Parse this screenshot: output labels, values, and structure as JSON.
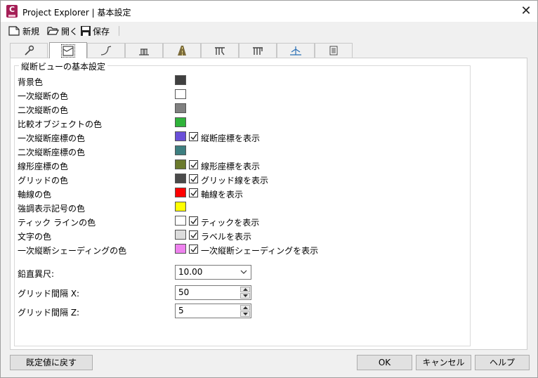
{
  "window": {
    "title": "Project Explorer | 基本設定",
    "app_icon_letter": "C",
    "close_glyph": "✕"
  },
  "toolbar": {
    "new_label": "新規",
    "open_label": "開く",
    "save_label": "保存"
  },
  "tabs": [
    {
      "icon": "wrench-icon",
      "active": false
    },
    {
      "icon": "profile-view-icon",
      "active": true
    },
    {
      "icon": "alignment-icon",
      "active": false
    },
    {
      "icon": "section-view-icon",
      "active": false
    },
    {
      "icon": "road-icon",
      "active": false
    },
    {
      "icon": "assembly-icon",
      "active": false
    },
    {
      "icon": "subassembly-icon",
      "active": false
    },
    {
      "icon": "cross-section-icon",
      "active": false
    },
    {
      "icon": "report-icon",
      "active": false
    }
  ],
  "group": {
    "title": "縦断ビューの基本設定"
  },
  "rows": [
    {
      "label": "背景色",
      "color": "#404040"
    },
    {
      "label": "一次縦断の色",
      "color": "#ffffff"
    },
    {
      "label": "二次縦断の色",
      "color": "#808080"
    },
    {
      "label": "比較オブジェクトの色",
      "color": "#2fb33a"
    },
    {
      "label": "一次縦断座標の色",
      "color": "#6a4fd8",
      "checkbox": {
        "checked": true,
        "label": "縦断座標を表示"
      }
    },
    {
      "label": "二次縦断座標の色",
      "color": "#3d7f80"
    },
    {
      "label": "線形座標の色",
      "color": "#6b7a2c",
      "checkbox": {
        "checked": true,
        "label": "線形座標を表示"
      }
    },
    {
      "label": "グリッドの色",
      "color": "#4a4a4a",
      "checkbox": {
        "checked": true,
        "label": "グリッド線を表示"
      }
    },
    {
      "label": "軸線の色",
      "color": "#ff0000",
      "checkbox": {
        "checked": true,
        "label": "軸線を表示"
      }
    },
    {
      "label": "強調表示記号の色",
      "color": "#ffff00"
    },
    {
      "label": "ティック ラインの色",
      "color": "#ffffff",
      "checkbox": {
        "checked": true,
        "label": "ティックを表示"
      }
    },
    {
      "label": "文字の色",
      "color": "#dcdcdc",
      "checkbox": {
        "checked": true,
        "label": "ラベルを表示"
      }
    },
    {
      "label": "一次縦断シェーディングの色",
      "color": "#ee82ee",
      "checkbox": {
        "checked": true,
        "label": "一次縦断シェーディングを表示"
      }
    }
  ],
  "fields": {
    "vertical_exaggeration": {
      "label": "鉛直異尺:",
      "value": "10.00"
    },
    "grid_x": {
      "label": "グリッド間隔 X:",
      "value": "50"
    },
    "grid_z": {
      "label": "グリッド間隔 Z:",
      "value": "5"
    }
  },
  "buttons": {
    "reset": "既定値に戻す",
    "ok": "OK",
    "cancel": "キャンセル",
    "help": "ヘルプ"
  }
}
